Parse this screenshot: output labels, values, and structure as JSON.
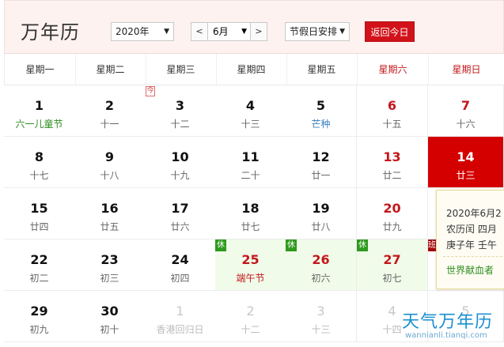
{
  "header": {
    "title": "万年历",
    "year_value": "2020年",
    "month_prev": "<",
    "month_value": "6月",
    "month_next": ">",
    "holiday_value": "节假日安排",
    "today_button": "返回今日",
    "dropdown_icon": "▼"
  },
  "weekdays": [
    "星期一",
    "星期二",
    "星期三",
    "星期四",
    "星期五",
    "星期六",
    "星期日"
  ],
  "today_badge": "今",
  "rest_badge": "休",
  "work_badge": "班",
  "weeks": [
    [
      {
        "day": "1",
        "lunar": "六一儿童节"
      },
      {
        "day": "2",
        "lunar": "十一"
      },
      {
        "day": "3",
        "lunar": "十二"
      },
      {
        "day": "4",
        "lunar": "十三"
      },
      {
        "day": "5",
        "lunar": "芒种"
      },
      {
        "day": "6",
        "lunar": "十五"
      },
      {
        "day": "7",
        "lunar": "十六"
      }
    ],
    [
      {
        "day": "8",
        "lunar": "十七"
      },
      {
        "day": "9",
        "lunar": "十八"
      },
      {
        "day": "10",
        "lunar": "十九"
      },
      {
        "day": "11",
        "lunar": "二十"
      },
      {
        "day": "12",
        "lunar": "廿一"
      },
      {
        "day": "13",
        "lunar": "廿二"
      },
      {
        "day": "14",
        "lunar": "廿三"
      }
    ],
    [
      {
        "day": "15",
        "lunar": "廿四"
      },
      {
        "day": "16",
        "lunar": "廿五"
      },
      {
        "day": "17",
        "lunar": "廿六"
      },
      {
        "day": "18",
        "lunar": "廿七"
      },
      {
        "day": "19",
        "lunar": "廿八"
      },
      {
        "day": "20",
        "lunar": "廿九"
      },
      {
        "day": "",
        "lunar": ""
      }
    ],
    [
      {
        "day": "22",
        "lunar": "初二"
      },
      {
        "day": "23",
        "lunar": "初三"
      },
      {
        "day": "24",
        "lunar": "初四"
      },
      {
        "day": "25",
        "lunar": "端午节"
      },
      {
        "day": "26",
        "lunar": "初六"
      },
      {
        "day": "27",
        "lunar": "初七"
      },
      {
        "day": "",
        "lunar": ""
      }
    ],
    [
      {
        "day": "29",
        "lunar": "初九"
      },
      {
        "day": "30",
        "lunar": "初十"
      },
      {
        "day": "1",
        "lunar": "香港回归日"
      },
      {
        "day": "2",
        "lunar": "十二"
      },
      {
        "day": "3",
        "lunar": "十三"
      },
      {
        "day": "4",
        "lunar": "十四"
      },
      {
        "day": "5",
        "lunar": ""
      }
    ]
  ],
  "popup": {
    "line1": "2020年6月2",
    "line2": "农历闰 四月",
    "line3": "庚子年 壬午",
    "festival": "世界献血者"
  },
  "watermark": {
    "main": "天气万年历",
    "sub": "wannianli.tianqi.com"
  },
  "colors": {
    "accent": "#d40000",
    "weekend": "#c3181c",
    "holiday_bg": "#f0fbe9",
    "festival_green": "#2f8d22"
  }
}
